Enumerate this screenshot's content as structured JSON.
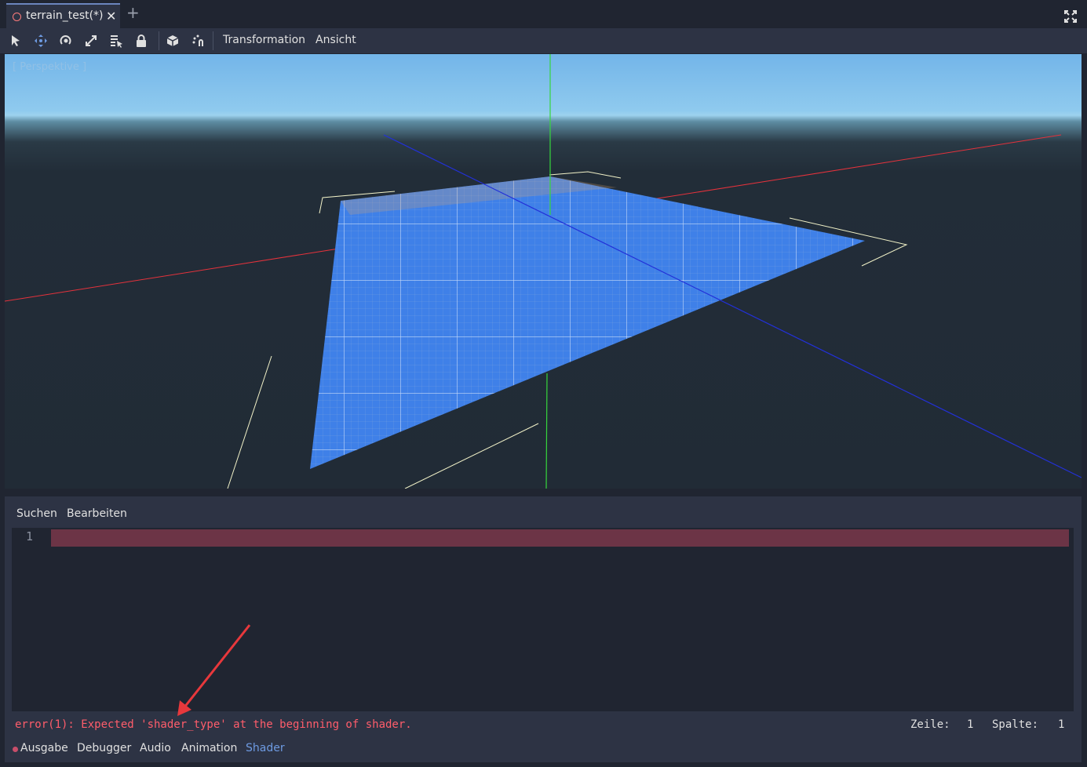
{
  "tabs": [
    {
      "title": "terrain_test(*)",
      "icon": "scene-circle-icon",
      "active": true
    }
  ],
  "toolbar": {
    "tools": [
      "select-icon",
      "move-icon",
      "rotate-icon",
      "scale-icon",
      "list-select-icon",
      "lock-icon",
      "camera-box-icon",
      "snap-icon"
    ],
    "menus": {
      "transformation": "Transformation",
      "ansicht": "Ansicht"
    }
  },
  "viewport": {
    "label": "[ Perspektive ]",
    "axis_colors": {
      "x": "#e5323c",
      "y": "#36d63c",
      "z": "#2230d8"
    },
    "mesh_color": "#3f80e8"
  },
  "panel": {
    "menus": {
      "suchen": "Suchen",
      "bearbeiten": "Bearbeiten"
    },
    "editor": {
      "line_number": "1"
    },
    "error": "error(1): Expected 'shader_type' at the beginning of shader.",
    "status": {
      "zeile_label": "Zeile:",
      "zeile_value": "1",
      "spalte_label": "Spalte:",
      "spalte_value": "1"
    },
    "bottom_tabs": {
      "ausgabe": "Ausgabe",
      "debugger": "Debugger",
      "audio": "Audio",
      "animation": "Animation",
      "shader": "Shader"
    },
    "colors": {
      "error_text": "#ff5d6b",
      "error_line": "#6c3446",
      "active_tab": "#6e9be2"
    }
  }
}
